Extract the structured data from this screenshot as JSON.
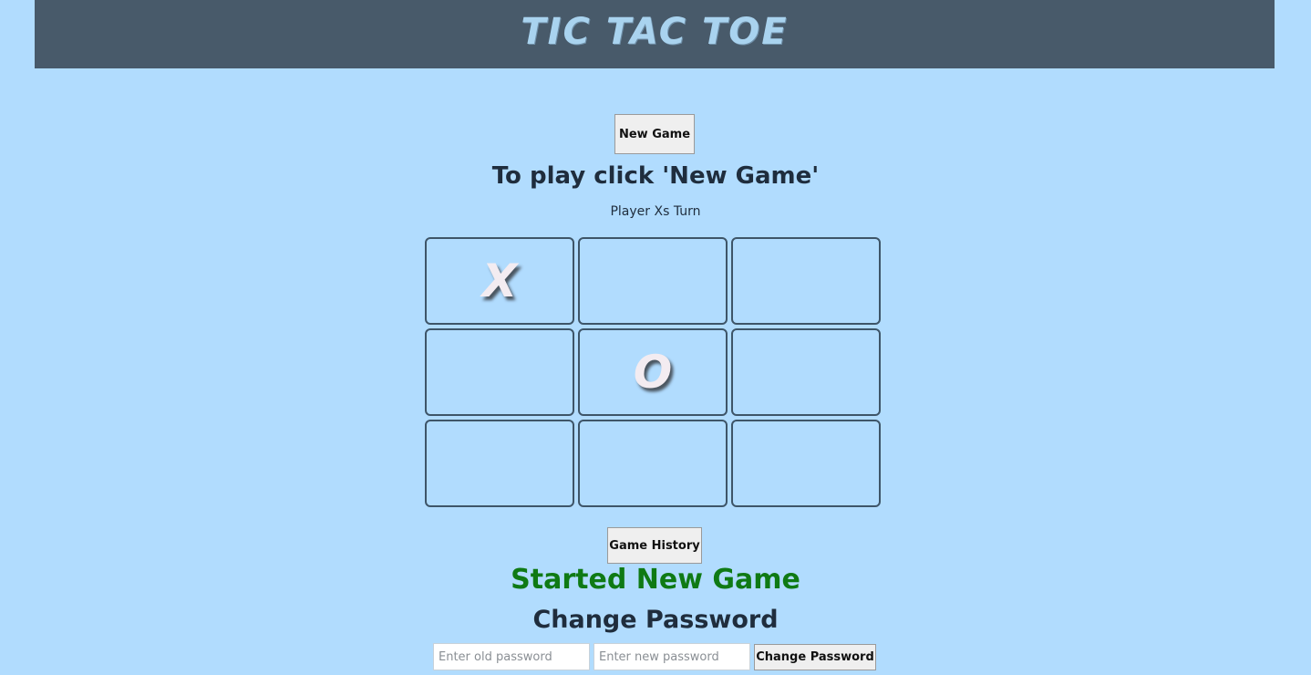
{
  "header": {
    "title": "TIC TAC TOE"
  },
  "controls": {
    "new_game_label": "New Game",
    "game_history_label": "Game History"
  },
  "instructions": "To play click 'New Game'",
  "turn_text": "Player Xs Turn",
  "board": {
    "cells": [
      "X",
      "",
      "",
      "",
      "O",
      "",
      "",
      "",
      ""
    ]
  },
  "status_message": "Started New Game",
  "change_password": {
    "title": "Change Password",
    "old_placeholder": "Enter old password",
    "new_placeholder": "Enter new password",
    "submit_label": "Change Password"
  },
  "colors": {
    "background": "#b1dcfe",
    "header": "#485a6a",
    "status": "#0f7a14"
  }
}
